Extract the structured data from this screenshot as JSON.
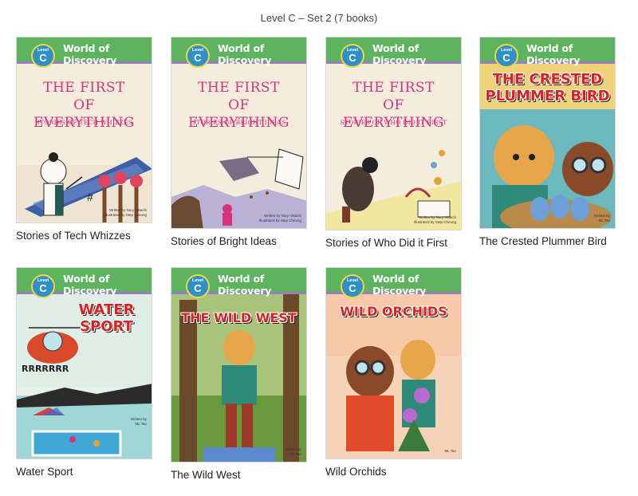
{
  "heading": "Level C – Set 2 (7 books)",
  "series_name": "World of Discovery",
  "level_label": "Level",
  "level_letter": "C",
  "books": [
    {
      "title": "Stories of Tech Whizzes",
      "cover_title_1": "THE FIRST",
      "cover_title_2": "OF EVERYTHING",
      "cover_subtitle": "STORIES OF TECH WHIZZES",
      "credit_1": "Written by Nury Vittachi",
      "credit_2": "Illustrated by Step Cheung"
    },
    {
      "title": "Stories of Bright Ideas",
      "cover_title_1": "THE FIRST",
      "cover_title_2": "OF EVERYTHING",
      "cover_subtitle": "STORIES OF BRIGHT IDEAS",
      "credit_1": "Written by Nury Vittachi",
      "credit_2": "Illustrated by Step Cheung"
    },
    {
      "title": "Stories of Who Did it First",
      "cover_title_1": "THE FIRST",
      "cover_title_2": "OF EVERYTHING",
      "cover_subtitle": "STORIES OF WHO DID IT FIRST",
      "credit_1": "Written by Nury Vittachi",
      "credit_2": "Illustrated by Step Cheung"
    },
    {
      "title": "The Crested Plummer Bird",
      "cover_title_1": "THE CRESTED",
      "cover_title_2": "PLUMMER BIRD",
      "credit_1": "Written by",
      "credit_2": "ML Tan"
    },
    {
      "title": "Water Sport",
      "cover_title_1": "WATER",
      "cover_title_2": "SPORT",
      "sound": "RRRRRRR",
      "credit_1": "Written by",
      "credit_2": "ML Tan"
    },
    {
      "title": "The Wild West",
      "cover_title_1": "THE WILD WEST",
      "credit_1": "Written by",
      "credit_2": "ML Tan"
    },
    {
      "title": "Wild Orchids",
      "cover_title_1": "WILD ORCHIDS",
      "credit_1": "",
      "credit_2": "ML Tan"
    }
  ]
}
